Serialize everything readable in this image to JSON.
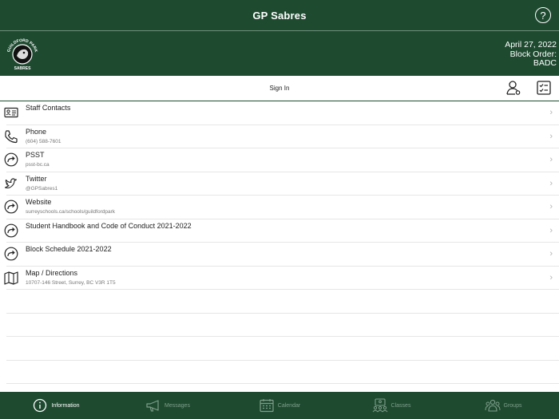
{
  "app": {
    "title": "GP Sabres"
  },
  "banner": {
    "date": "April 27, 2022",
    "block_order_label": "Block Order:",
    "block_order_value": "BADC",
    "logo_top_text": "GUILDFORD PARK",
    "logo_bottom_text": "SABRES"
  },
  "toolbar": {
    "sign_in": "Sign In"
  },
  "items": [
    {
      "title": "Staff Contacts",
      "subtitle": "",
      "icon": "contact-card-icon"
    },
    {
      "title": "Phone",
      "subtitle": "(604) 588-7601",
      "icon": "phone-icon"
    },
    {
      "title": "PSST",
      "subtitle": "psst-bc.ca",
      "icon": "redirect-icon"
    },
    {
      "title": "Twitter",
      "subtitle": "@GPSabres1",
      "icon": "twitter-icon"
    },
    {
      "title": "Website",
      "subtitle": "surreyschools.ca/schools/guildfordpark",
      "icon": "redirect-icon"
    },
    {
      "title": "Student Handbook and Code of Conduct 2021-2022",
      "subtitle": "",
      "icon": "redirect-icon"
    },
    {
      "title": "Block Schedule 2021-2022",
      "subtitle": "",
      "icon": "redirect-icon"
    },
    {
      "title": "Map / Directions",
      "subtitle": "10707-146 Street, Surrey, BC V3R 1T5",
      "icon": "map-icon"
    }
  ],
  "tabs": [
    {
      "label": "Information",
      "icon": "info-icon",
      "active": true
    },
    {
      "label": "Messages",
      "icon": "megaphone-icon",
      "active": false
    },
    {
      "label": "Calendar",
      "icon": "calendar-icon",
      "active": false
    },
    {
      "label": "Classes",
      "icon": "classes-icon",
      "active": false
    },
    {
      "label": "Groups",
      "icon": "groups-icon",
      "active": false
    }
  ],
  "colors": {
    "brand": "#1e4a30",
    "inactive_tab": "#7f9e8b"
  }
}
